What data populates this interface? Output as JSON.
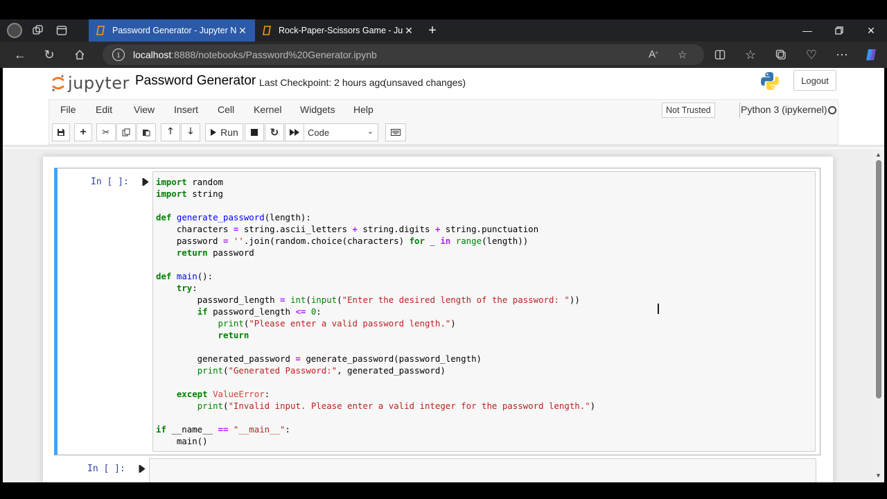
{
  "browser": {
    "tabs": [
      {
        "title": "Password Generator - Jupyter Ne",
        "active": true
      },
      {
        "title": "Rock-Paper-Scissors Game - Jupy",
        "active": false
      }
    ],
    "url_host": "localhost",
    "url_path": ":8888/notebooks/Password%20Generator.ipynb"
  },
  "jupyter": {
    "logo_text": "jupyter",
    "notebook_title": "Password Generator",
    "checkpoint": "Last Checkpoint: 2 hours ago",
    "status": "(unsaved changes)",
    "logout_label": "Logout",
    "menu": [
      "File",
      "Edit",
      "View",
      "Insert",
      "Cell",
      "Kernel",
      "Widgets",
      "Help"
    ],
    "trust_label": "Not Trusted",
    "kernel_name": "Python 3 (ipykernel)",
    "run_label": "Run",
    "cell_type": "Code"
  },
  "cells": [
    {
      "prompt": "In [ ]:"
    },
    {
      "prompt": "In [ ]:"
    }
  ],
  "colors": {
    "tab_active": "#2b5aa8",
    "cell_selected_border": "#42a5f5",
    "prompt": "#303f9f",
    "keyword": "#008000",
    "function_name": "#0000ff",
    "string": "#ba2121",
    "operator": "#aa22ff"
  },
  "code_text": "import random\nimport string\n\ndef generate_password(length):\n    characters = string.ascii_letters + string.digits + string.punctuation\n    password = ''.join(random.choice(characters) for _ in range(length))\n    return password\n\ndef main():\n    try:\n        password_length = int(input(\"Enter the desired length of the password: \"))\n        if password_length <= 0:\n            print(\"Please enter a valid password length.\")\n            return\n\n        generated_password = generate_password(password_length)\n        print(\"Generated Password:\", generated_password)\n\n    except ValueError:\n        print(\"Invalid input. Please enter a valid integer for the password length.\")\n\nif __name__ == \"__main__\":\n    main()"
}
